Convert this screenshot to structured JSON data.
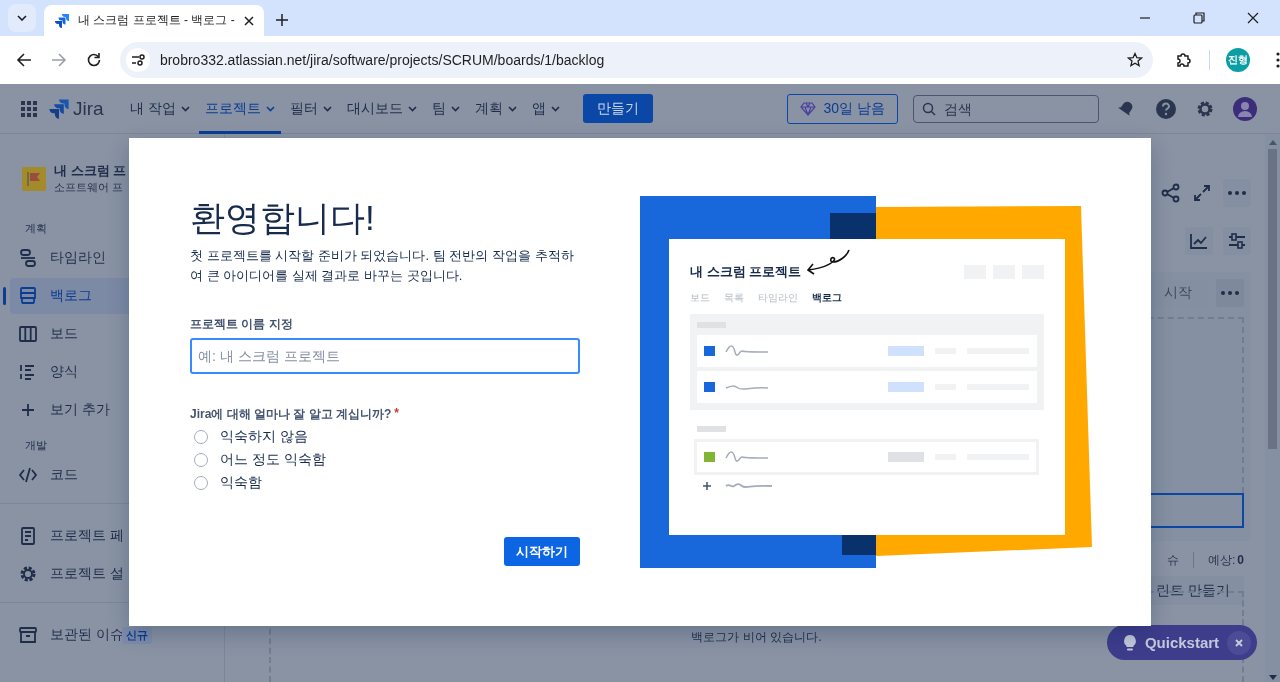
{
  "browser": {
    "tab_title": "내 스크럼 프로젝트 - 백로그 -",
    "url": "brobro332.atlassian.net/jira/software/projects/SCRUM/boards/1/backlog",
    "profile": "진형"
  },
  "nav": {
    "logo": "Jira",
    "items": [
      {
        "label": "내 작업",
        "selected": false
      },
      {
        "label": "프로젝트",
        "selected": true
      },
      {
        "label": "필터",
        "selected": false
      },
      {
        "label": "대시보드",
        "selected": false
      },
      {
        "label": "팀",
        "selected": false
      },
      {
        "label": "계획",
        "selected": false
      },
      {
        "label": "앱",
        "selected": false
      }
    ],
    "create": "만들기",
    "trial": "30일 남음",
    "search_placeholder": "검색"
  },
  "sidebar": {
    "project_name": "내 스크럼 프",
    "project_type": "소프트웨어 프",
    "groups": [
      {
        "heading": "계획",
        "items": [
          {
            "label": "타임라인",
            "kind": "timeline",
            "selected": false
          },
          {
            "label": "백로그",
            "kind": "backlog",
            "selected": true
          },
          {
            "label": "보드",
            "kind": "board",
            "selected": false
          },
          {
            "label": "양식",
            "kind": "forms",
            "selected": false
          },
          {
            "label": "보기 추가",
            "kind": "add",
            "selected": false
          }
        ]
      },
      {
        "heading": "개발",
        "items": [
          {
            "label": "코드",
            "kind": "code",
            "selected": false
          }
        ]
      },
      {
        "items": [
          {
            "label": "프로젝트 페",
            "kind": "page",
            "selected": false
          },
          {
            "label": "프로젝트 설",
            "kind": "settings",
            "selected": false
          }
        ]
      },
      {
        "items": [
          {
            "label": "보관된 이슈",
            "kind": "archive",
            "selected": false,
            "badge": "신규"
          }
        ]
      }
    ]
  },
  "board": {
    "sprint_start": "시작",
    "issues_fragment": "슈",
    "estimate_label": "예상:",
    "estimate_value": "0",
    "create_sprint": "린트 만들기",
    "backlog_empty": "백로그가 비어 있습니다.",
    "quickstart": "Quickstart"
  },
  "modal": {
    "title": "환영합니다!",
    "description": "첫 프로젝트를 시작할 준비가 되었습니다. 팀 전반의 작업을 추적하여 큰 아이디어를 실제 결과로 바꾸는 곳입니다.",
    "name_label": "프로젝트 이름 지정",
    "name_placeholder": "예: 내 스크럼 프로젝트",
    "question": "Jira에 대해 얼마나 잘 알고 계십니까?",
    "required": "*",
    "options": [
      {
        "label": "익숙하지 않음",
        "selected": false
      },
      {
        "label": "어느 정도 익숙함",
        "selected": false
      },
      {
        "label": "익숙함",
        "selected": false
      }
    ],
    "submit": "시작하기",
    "illustration": {
      "title": "내 스크럼 프로젝트",
      "tabs": [
        {
          "label": "보드",
          "selected": false
        },
        {
          "label": "목록",
          "selected": false
        },
        {
          "label": "타임라인",
          "selected": false
        },
        {
          "label": "백로그",
          "selected": true
        }
      ]
    }
  }
}
